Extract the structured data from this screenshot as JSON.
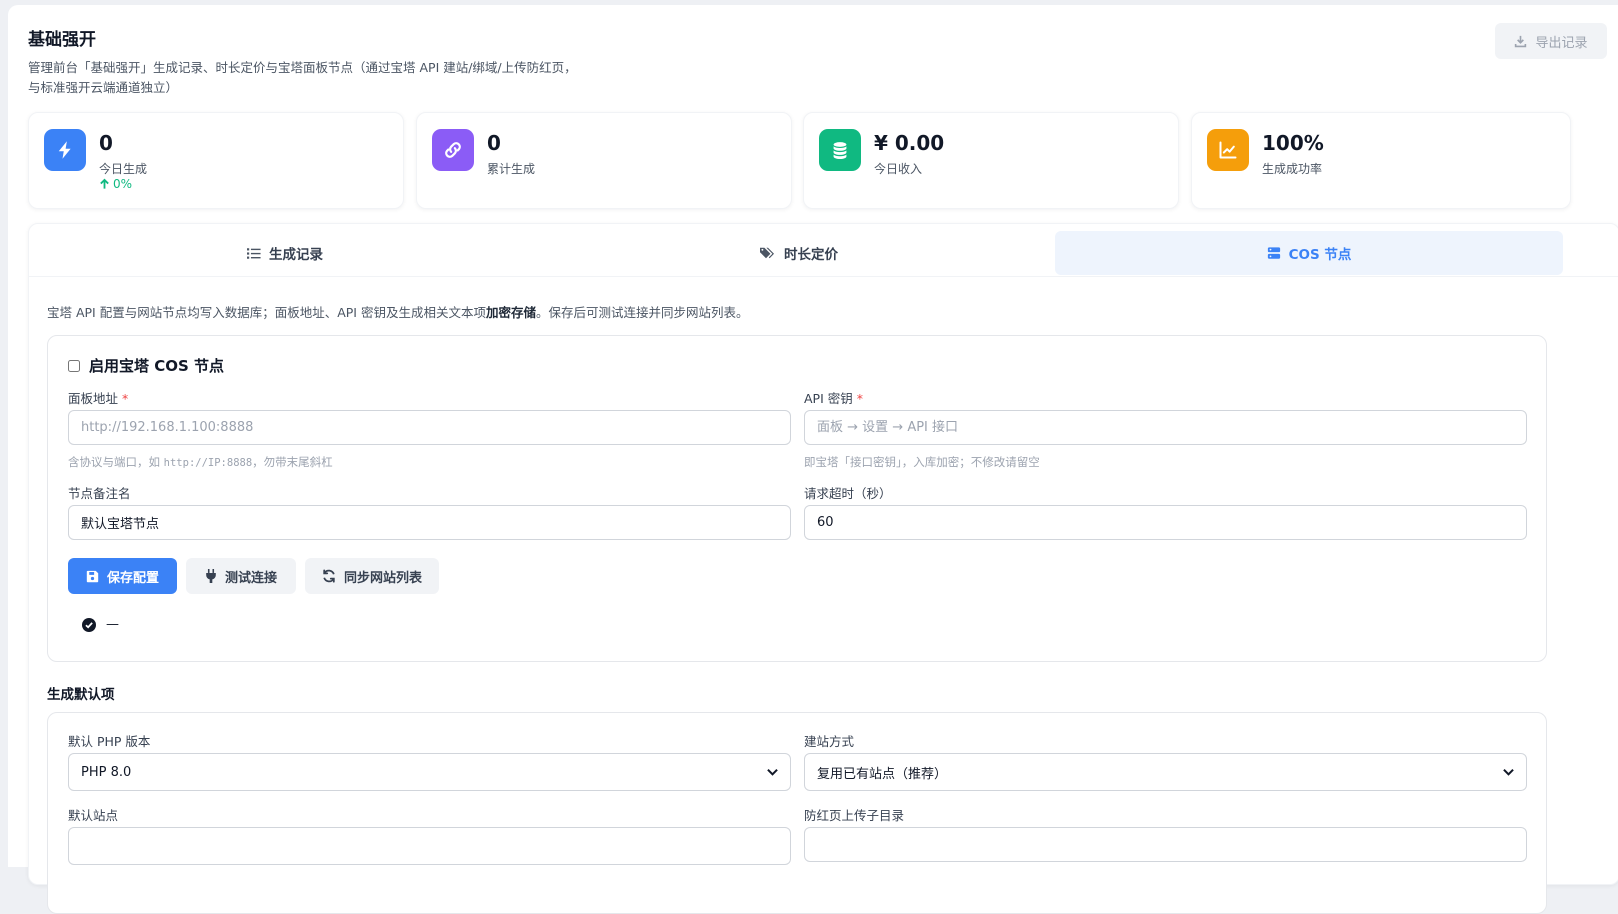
{
  "header": {
    "title": "基础强开",
    "subtitle": "管理前台「基础强开」生成记录、时长定价与宝塔面板节点（通过宝塔 API 建站/绑域/上传防红页，与标准强开云端通道独立）",
    "export_label": "导出记录"
  },
  "stats": [
    {
      "value": "0",
      "label": "今日生成",
      "trend": "0%",
      "color": "#3b82f6",
      "icon": "lightning-icon"
    },
    {
      "value": "0",
      "label": "累计生成",
      "color": "#8b5cf6",
      "icon": "link-icon"
    },
    {
      "value": "¥ 0.00",
      "label": "今日收入",
      "color": "#10b981",
      "icon": "coins-icon"
    },
    {
      "value": "100%",
      "label": "生成成功率",
      "color": "#f59e0b",
      "icon": "chart-line-icon"
    }
  ],
  "tabs": [
    {
      "label": "生成记录",
      "icon": "list-icon"
    },
    {
      "label": "时长定价",
      "icon": "tags-icon"
    },
    {
      "label": "COS 节点",
      "icon": "server-icon",
      "active": true
    }
  ],
  "notice": {
    "part1": "宝塔 API 配置与网站节点均写入数据库；面板地址、API 密钥及生成相关文本项",
    "bold": "加密存储",
    "part2": "。保存后可测试连接并同步网站列表。"
  },
  "node_config": {
    "enable_label": "启用宝塔 COS 节点",
    "enabled": false,
    "panel_url": {
      "label": "面板地址",
      "required_mark": "*",
      "placeholder": "http://192.168.1.100:8888",
      "value": "",
      "hint_prefix": "含协议与端口，如 ",
      "hint_code": "http://IP:8888",
      "hint_suffix": "，勿带末尾斜杠"
    },
    "api_key": {
      "label": "API 密钥",
      "required_mark": "*",
      "placeholder": "面板 → 设置 → API 接口",
      "value": "",
      "hint": "即宝塔「接口密钥」，入库加密；不修改请留空"
    },
    "node_name": {
      "label": "节点备注名",
      "value": "默认宝塔节点"
    },
    "timeout": {
      "label": "请求超时（秒）",
      "value": "60"
    },
    "buttons": {
      "save": "保存配置",
      "test": "测试连接",
      "sync": "同步网站列表"
    },
    "status_text": "—"
  },
  "defaults": {
    "section_title": "生成默认项",
    "php_version": {
      "label": "默认 PHP 版本",
      "value": "PHP 8.0"
    },
    "build_mode": {
      "label": "建站方式",
      "value": "复用已有站点（推荐）"
    },
    "default_site": {
      "label": "默认站点"
    },
    "upload_dir": {
      "label": "防红页上传子目录"
    }
  }
}
